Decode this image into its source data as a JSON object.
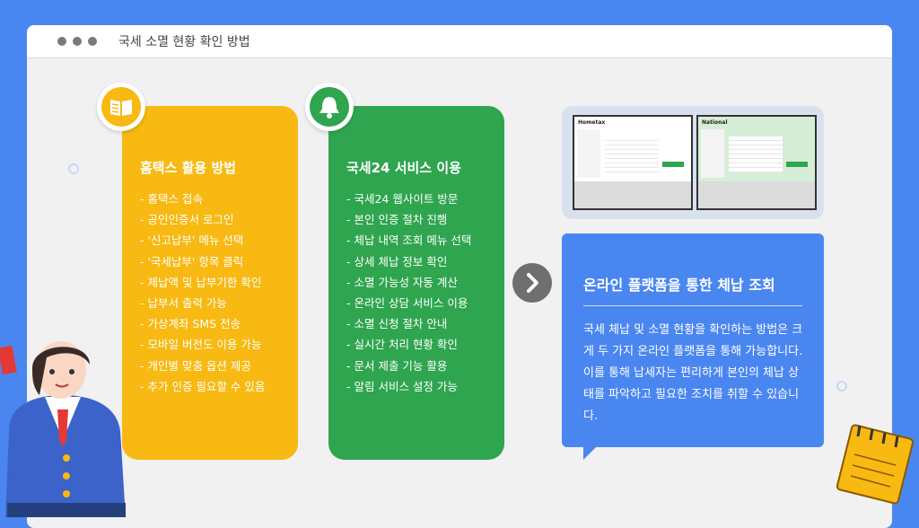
{
  "window": {
    "title": "국세 소멸 현황 확인 방법"
  },
  "hometax": {
    "title": "홈택스 활용 방법",
    "items": [
      "- 홈택스 접속",
      "- 공인인증서 로그인",
      "- '신고납부' 메뉴 선택",
      "- '국세납부' 항목 클릭",
      "- 체납액 및 납부기한 확인",
      "- 납부서 출력 가능",
      "- 가상계좌 SMS 전송",
      "- 모바일 버전도 이용 가능",
      "- 개인별 맞춤 옵션 제공",
      "- 추가 인증 필요할 수 있음"
    ]
  },
  "tax24": {
    "title": "국세24 서비스 이용",
    "items": [
      "- 국세24 웹사이트 방문",
      "- 본인 인증 절차 진행",
      "- 체납 내역 조회 메뉴 선택",
      "- 상세 체납 정보 확인",
      "- 소멸 가능성 자동 계산",
      "- 온라인 상담 서비스 이용",
      "- 소멸 신청 절차 안내",
      "- 실시간 처리 현황 확인",
      "- 문서 제출 기능 활용",
      "- 알림 서비스 설정 가능"
    ]
  },
  "screenshots": {
    "left_title": "Hometax",
    "right_title": "National"
  },
  "summary": {
    "title": "온라인 플랫폼을 통한 체납 조회",
    "body": "국세 체납 및 소멸 현황을 확인하는 방법은 크게 두 가지 온라인 플랫폼을 통해 가능합니다. 이를 통해 납세자는 편리하게 본인의 체납 상태를 파악하고 필요한 조치를 취할 수 있습니다."
  },
  "icons": {
    "hometax": "book-icon",
    "tax24": "bell-icon",
    "next": "chevron-right-icon"
  },
  "colors": {
    "background": "#4a86f0",
    "hometax_card": "#f7b912",
    "tax24_card": "#2fa54f",
    "summary": "#4a86f0"
  }
}
